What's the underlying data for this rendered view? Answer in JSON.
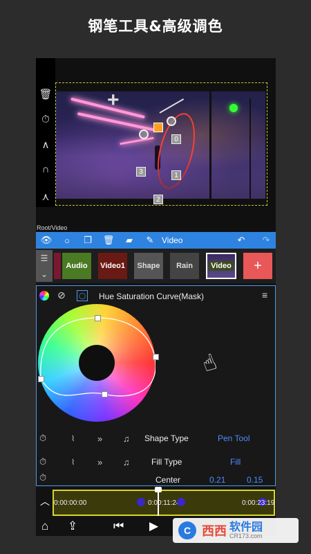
{
  "promo_title": "钢笔工具&高级调色",
  "root_label": "Root/Video",
  "toolbar": {
    "label": "Video"
  },
  "layers": [
    {
      "label": "Audio",
      "bg": "#4a7a24",
      "color": "#ffffff"
    },
    {
      "label": "Video1",
      "bg": "#6a1a14",
      "color": "#ffffff"
    },
    {
      "label": "Shape",
      "bg": "#555555",
      "color": "#dddddd"
    },
    {
      "label": "Rain",
      "bg": "#444444",
      "color": "#dddddd"
    },
    {
      "label": "Video",
      "bg": "#3e4a1e",
      "color": "#ffffff"
    }
  ],
  "add_layer": "+",
  "scene_handles": [
    "0",
    "1",
    "2",
    "3"
  ],
  "panel": {
    "title": "Hue Saturation Curve(Mask)"
  },
  "properties": [
    {
      "name": "Shape Type",
      "value": "Pen Tool"
    },
    {
      "name": "Fill Type",
      "value": "Fill"
    },
    {
      "name": "Center",
      "value_x": "0.21",
      "value_y": "0.15"
    }
  ],
  "timeline": {
    "start": "0:00:00:00",
    "current": "0:00:11:24",
    "end": "0:00:23:19"
  },
  "watermark": {
    "brand": "西西",
    "text": "软件园",
    "url": "CR173.com"
  },
  "colors": {
    "accent": "#2f83e0",
    "timeline_border": "#d6d630",
    "prop_value": "#4d8cff",
    "add_button": "#e85858"
  }
}
